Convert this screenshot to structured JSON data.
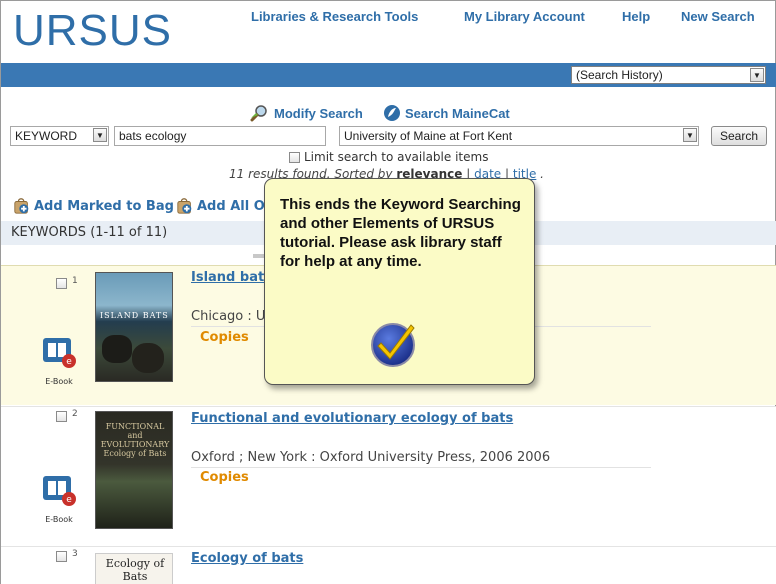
{
  "header": {
    "logo": "URSUS",
    "nav": [
      "Libraries & Research Tools",
      "My Library Account",
      "Help",
      "New Search"
    ],
    "search_history": "(Search History)"
  },
  "tools": {
    "modify_search": "Modify Search",
    "search_mainecat": "Search MaineCat"
  },
  "search": {
    "type": "KEYWORD",
    "query": "bats ecology",
    "library": "University of Maine at Fort Kent",
    "button": "Search",
    "limit_label": "Limit search to available items",
    "results_prefix": "11 results found. Sorted by",
    "sort_relevance": "relevance",
    "sort_sep1": "|",
    "sort_date": "date",
    "sort_sep2": "|",
    "sort_title": "title",
    "sort_end": "."
  },
  "bag": {
    "add_marked": "Add Marked to Bag",
    "add_all": "Add All Or"
  },
  "keywords_label": "KEYWORDS (1-11 of 11)",
  "results": [
    {
      "num": "1",
      "title": "Island bats",
      "publisher": "Chicago : U",
      "copies": "Copies",
      "format": "E-Book",
      "cover_text": "ISLAND BATS"
    },
    {
      "num": "2",
      "title": "Functional and evolutionary ecology of bats",
      "publisher": "Oxford ; New York : Oxford University Press, 2006 2006",
      "copies": "Copies",
      "format": "E-Book",
      "cover_text": "FUNCTIONAL and EVOLUTIONARY Ecology of Bats"
    },
    {
      "num": "3",
      "title": "Ecology of bats",
      "cover_text": "Ecology of Bats"
    }
  ],
  "popup": {
    "message": "This ends the Keyword Searching and other Elements of URSUS tutorial. Please ask library staff for help at any time."
  },
  "colors": {
    "brand_blue": "#2f6ea8",
    "bar_blue": "#3a78b4",
    "copies_orange": "#e08a00",
    "popup_yellow": "#fbfbc6",
    "row_highlight": "#fdfbe3"
  },
  "icons": [
    "search-glass-icon",
    "mainecat-globe-icon",
    "add-to-bag-icon",
    "ebook-icon",
    "check-icon",
    "dropdown-arrow-icon"
  ]
}
